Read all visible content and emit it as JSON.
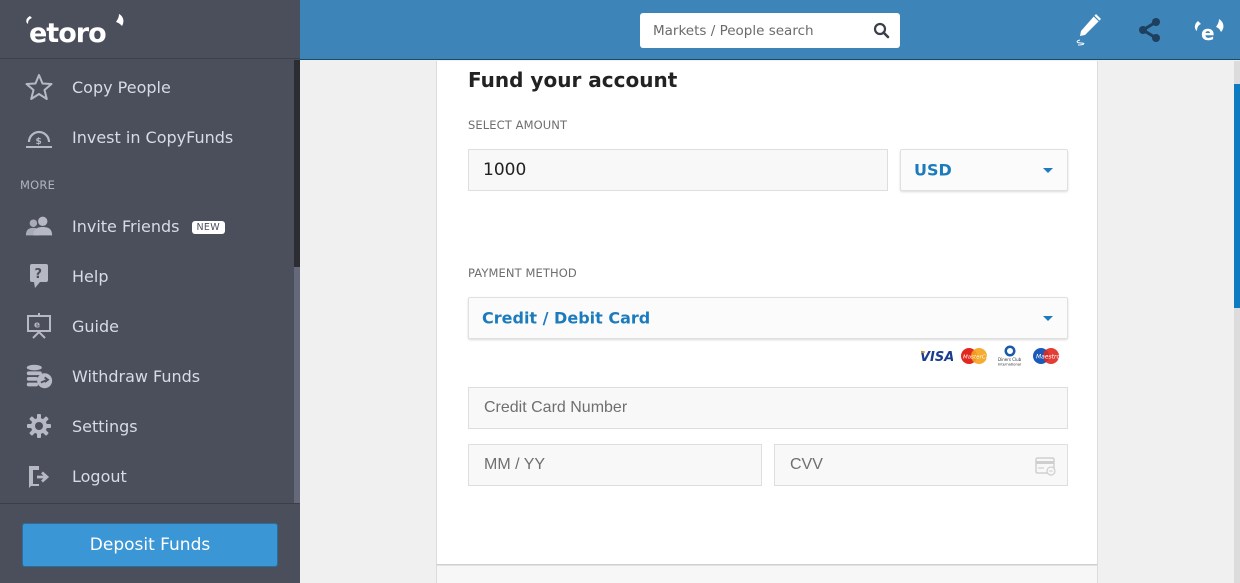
{
  "brand": {
    "name": "etoro",
    "accent": "#3d84b8",
    "button": "#3b96d6",
    "link": "#1b7bbd"
  },
  "sidebar": {
    "items": [
      {
        "label": "Copy People",
        "icon": "star-icon"
      },
      {
        "label": "Invest in CopyFunds",
        "icon": "copyfunds-icon"
      }
    ],
    "more_label": "MORE",
    "more_items": [
      {
        "label": "Invite Friends",
        "icon": "invite-friends-icon",
        "badge": "NEW"
      },
      {
        "label": "Help",
        "icon": "help-icon"
      },
      {
        "label": "Guide",
        "icon": "guide-icon"
      },
      {
        "label": "Withdraw Funds",
        "icon": "withdraw-icon"
      },
      {
        "label": "Settings",
        "icon": "gear-icon"
      },
      {
        "label": "Logout",
        "icon": "logout-icon"
      }
    ],
    "deposit_label": "Deposit Funds"
  },
  "topbar": {
    "search_placeholder": "Markets / People search",
    "icons": [
      "edit-pencil-icon",
      "share-icon",
      "etoro-profile-icon"
    ]
  },
  "form": {
    "title": "Fund your account",
    "amount_label": "SELECT AMOUNT",
    "amount_value": "1000",
    "currency": "USD",
    "payment_label": "PAYMENT METHOD",
    "payment_method": "Credit / Debit Card",
    "card_brands": [
      "VISA",
      "MasterCard",
      "Diners Club International",
      "Maestro"
    ],
    "card_number_placeholder": "Credit Card Number",
    "expiry_placeholder": "MM / YY",
    "cvv_placeholder": "CVV"
  }
}
